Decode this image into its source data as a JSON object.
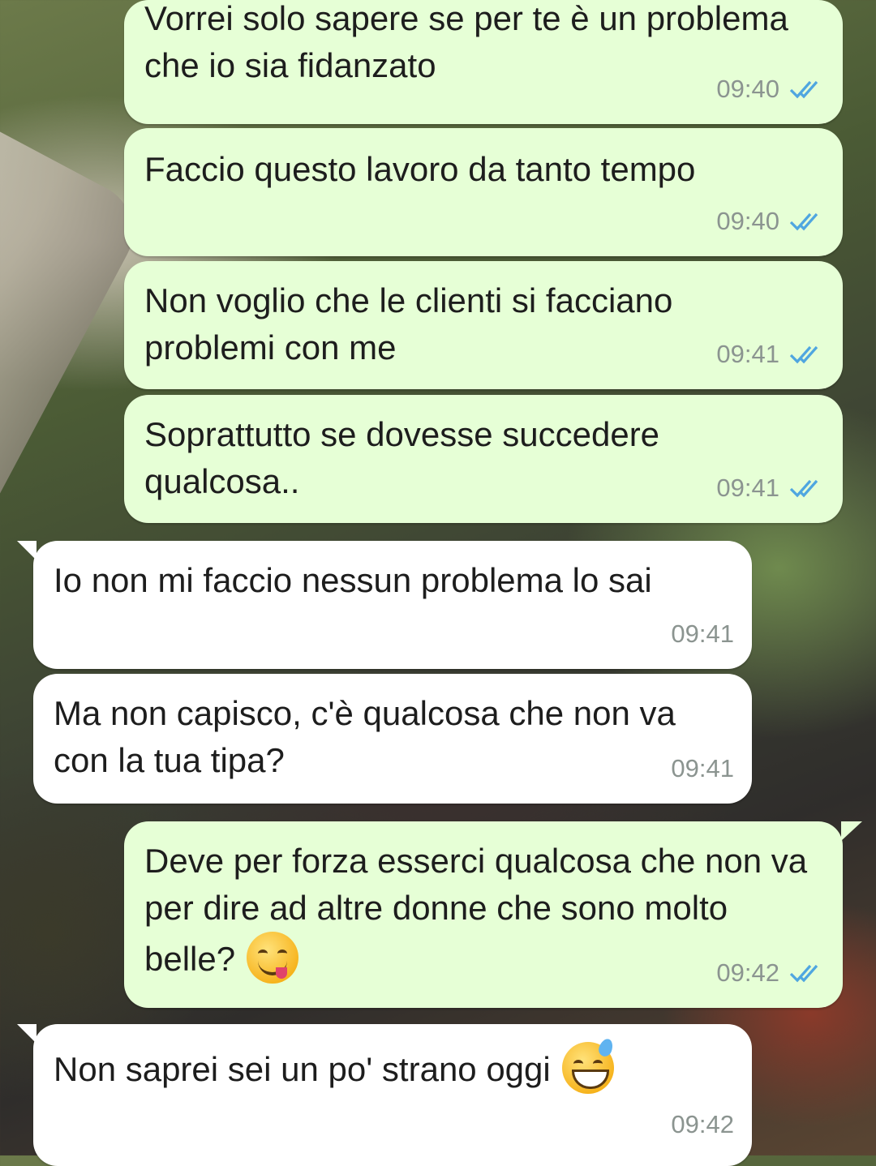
{
  "messages": [
    {
      "direction": "out",
      "text": "Vorrei solo sapere se per te è un problema che io sia fidanzato",
      "time": "09:40",
      "status": "read"
    },
    {
      "direction": "out",
      "text": "Faccio questo lavoro da tanto tempo",
      "time": "09:40",
      "status": "read"
    },
    {
      "direction": "out",
      "text": "Non voglio che le clienti si facciano problemi con me",
      "time": "09:41",
      "status": "read"
    },
    {
      "direction": "out",
      "text": "Soprattutto se dovesse succedere qualcosa..",
      "time": "09:41",
      "status": "read"
    },
    {
      "direction": "in",
      "text": "Io non mi faccio nessun problema lo sai",
      "time": "09:41"
    },
    {
      "direction": "in",
      "text": "Ma non capisco, c'è qualcosa che non va con la tua tipa?",
      "time": "09:41"
    },
    {
      "direction": "out",
      "text": "Deve per forza esserci qualcosa che non va per dire ad altre donne che sono molto belle?",
      "time": "09:42",
      "status": "read",
      "emoji": "face-savoring-food-emoji"
    },
    {
      "direction": "in",
      "text": "Non saprei sei un po' strano oggi",
      "time": "09:42",
      "emoji": "grinning-face-with-sweat-emoji"
    }
  ],
  "colors": {
    "outgoing_bubble": "#e6ffd6",
    "incoming_bubble": "#ffffff",
    "read_ticks": "#4fa6e0",
    "timestamp": "#8b9490"
  }
}
